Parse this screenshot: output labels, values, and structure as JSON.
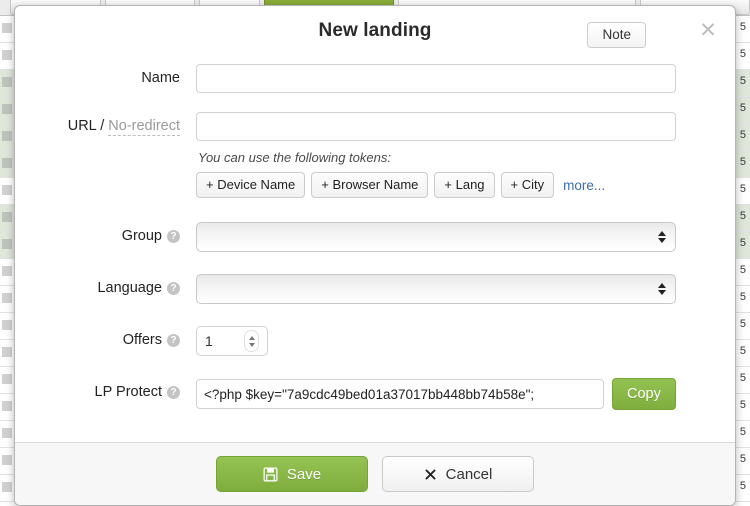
{
  "modal": {
    "title": "New landing",
    "note_button": "Note",
    "close_icon": "close-icon"
  },
  "form": {
    "name": {
      "label": "Name",
      "value": "",
      "placeholder": ""
    },
    "url": {
      "label_main": "URL /",
      "label_muted": "No-redirect",
      "value": "",
      "placeholder": ""
    },
    "tokens": {
      "hint": "You can use the following tokens:",
      "buttons": [
        "+ Device Name",
        "+ Browser Name",
        "+ Lang",
        "+ City"
      ],
      "more_link": "more..."
    },
    "group": {
      "label": "Group",
      "help_icon": "help-icon",
      "selected": ""
    },
    "language": {
      "label": "Language",
      "help_icon": "help-icon",
      "selected": ""
    },
    "offers": {
      "label": "Offers",
      "help_icon": "help-icon",
      "value": "1"
    },
    "lp_protect": {
      "label": "LP Protect",
      "help_icon": "help-icon",
      "value": "<?php $key=\"7a9cdc49bed01a37017bb448bb74b58e\";",
      "copy_button": "Copy"
    }
  },
  "footer": {
    "save_label": "Save",
    "save_icon": "save-floppy-icon",
    "cancel_label": "Cancel",
    "cancel_icon": "x-icon"
  },
  "colors": {
    "green": "#7fae3e",
    "link_blue": "#3b6ea8",
    "muted_gray": "#9a9a9a"
  }
}
